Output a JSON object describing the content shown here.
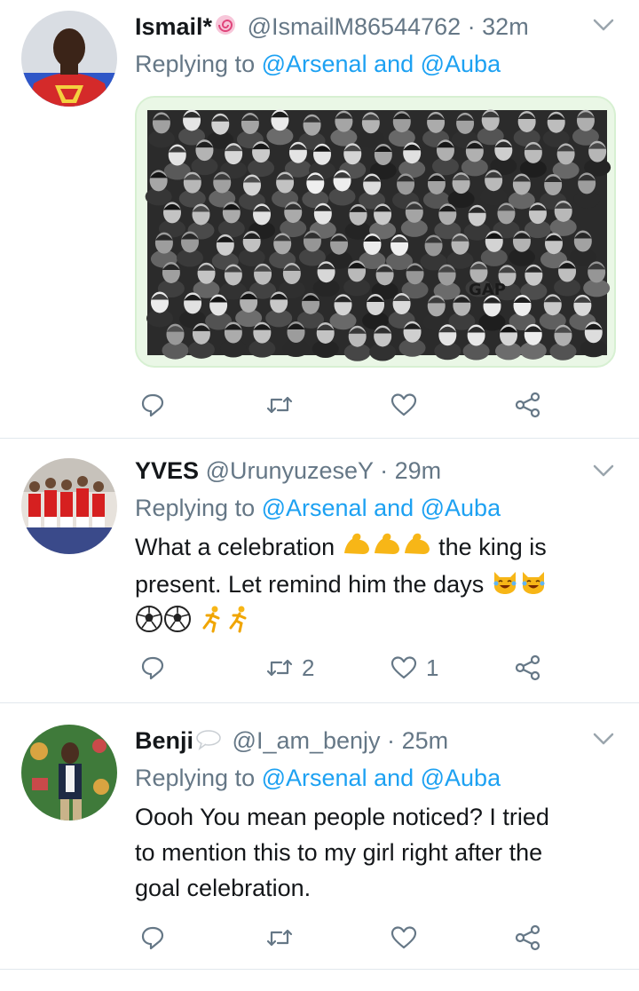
{
  "tweets": [
    {
      "name": "Ismail*",
      "name_icon": "lollipop-icon",
      "handle": "@IsmailM86544762",
      "separator": "·",
      "time": "32m",
      "replying_prefix": "Replying to",
      "replying_handles": "@Arsenal and @Auba",
      "text_lines": [],
      "has_media": true,
      "media_label": "GAP",
      "retweets": "",
      "likes": ""
    },
    {
      "name": "YVES",
      "name_icon": "",
      "handle": "@UrunyuzeseY",
      "separator": "·",
      "time": "29m",
      "replying_prefix": "Replying to",
      "replying_handles": "@Arsenal and @Auba",
      "text_line1": "What a celebration",
      "text_line1b": "the king is",
      "text_line2": "present. Let remind him the days",
      "has_media": false,
      "retweets": "2",
      "likes": "1"
    },
    {
      "name": "Benji",
      "name_icon": "speech-bubble-icon",
      "handle": "@I_am_benjy",
      "separator": "·",
      "time": "25m",
      "replying_prefix": "Replying to",
      "replying_handles": "@Arsenal and @Auba",
      "text_line1": "Oooh You mean people noticed? I tried",
      "text_line2": "to mention this to my girl right after the",
      "text_line3": "goal celebration.",
      "has_media": false,
      "retweets": "",
      "likes": ""
    }
  ],
  "colors": {
    "link": "#1da1f2",
    "meta": "#657786",
    "divider": "#e1e8ed"
  }
}
